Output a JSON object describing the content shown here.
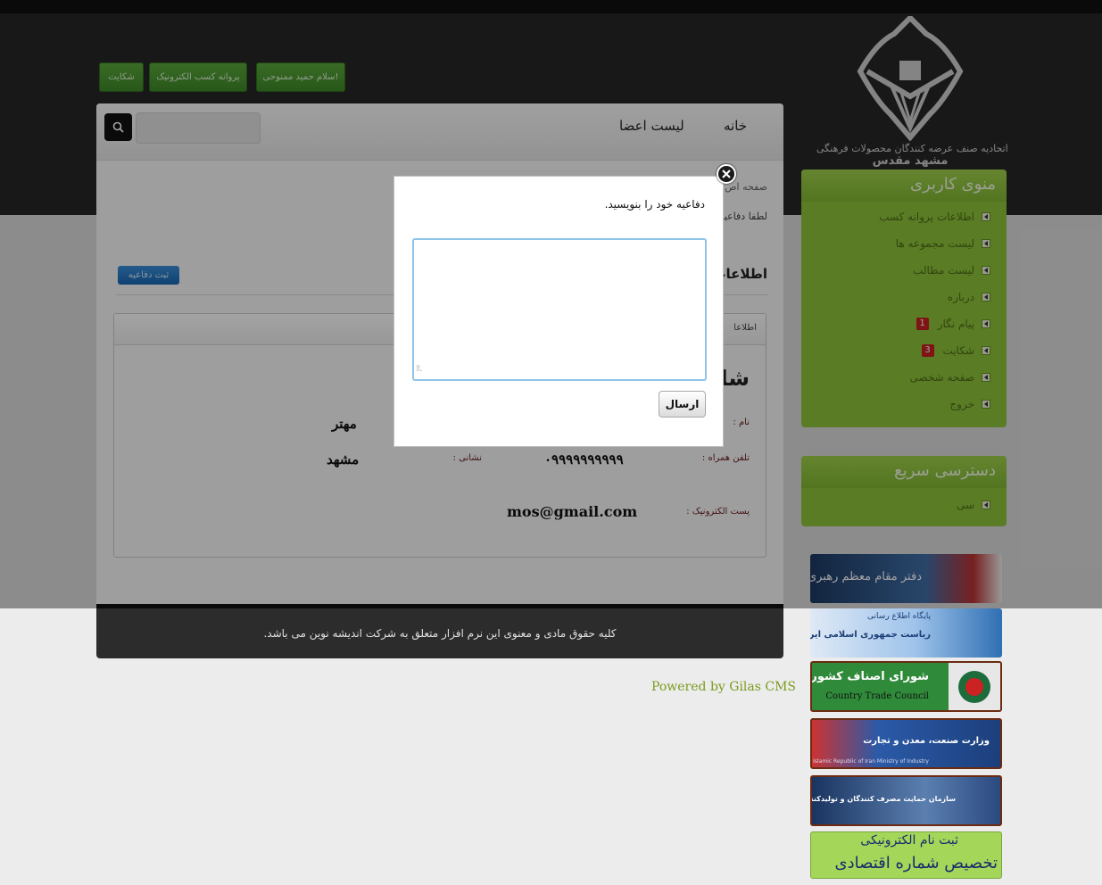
{
  "header": {
    "logo_line1": "اتحادیه صنف عرضه کنندگان محصولات فرهنگی",
    "logo_line2": "مشهد مقدس",
    "buttons": {
      "greeting": "سلام حمید ممنوحی!",
      "license": "پروانه کسب الکترونیک",
      "complaint": "شکایت"
    }
  },
  "nav": {
    "home": "خانه",
    "members": "لیست اعضا",
    "search_placeholder": ""
  },
  "content": {
    "breadcrumb": "صفحه اص",
    "instruction": "لطفا دفاعیه",
    "submit_defense": "ثبت دفاعیه",
    "section_title": "اطلاعات",
    "infobox_header": "اطلاعا",
    "big_letters": "شا",
    "fields": {
      "name_label": "نام :",
      "name_value": "مهتر",
      "mobile_label": "تلفن همراه :",
      "mobile_value": "۰۹۹۹۹۹۹۹۹۹۹",
      "address_label": "نشانی :",
      "address_value": "مشهد",
      "email_label": "پست الکترونیک :",
      "email_value": "mos@gmail.com"
    }
  },
  "footer": {
    "copyright": "کلیه حقوق مادی و معنوی این نرم افزار متعلق به شرکت اندیشه نوین می باشد.",
    "powered": "Powered by Gilas CMS"
  },
  "sidebar": {
    "user_menu": {
      "title": "منوی کاربری",
      "items": [
        {
          "label": "اطلاعات پروانه کسب",
          "badge": ""
        },
        {
          "label": "لیست مجموعه ها",
          "badge": ""
        },
        {
          "label": "لیست مطالب",
          "badge": ""
        },
        {
          "label": "درباره",
          "badge": ""
        },
        {
          "label": "پیام نگار",
          "badge": "1"
        },
        {
          "label": "شکایت",
          "badge": "3"
        },
        {
          "label": "صفحه شخصی",
          "badge": ""
        },
        {
          "label": "خروج",
          "badge": ""
        }
      ]
    },
    "quick_access": {
      "title": "دسترسی سریع",
      "items": [
        {
          "label": "سی"
        }
      ]
    }
  },
  "banners": {
    "leader": "دفتر مقام معظم رهبری",
    "president_top": "پایگاه اطلاع رسانی",
    "president": "ریاست جمهوری اسلامی ایران",
    "guild_fa": "شورای اصناف کشور",
    "guild_en": "Country Trade Council",
    "ministry": "وزارت صنعت، معدن و تجارت",
    "ministry_en": "Islamic Republic of Iran Ministry of Industry",
    "consumer": "سازمان حمایت مصرف کنندگان و تولیدکنندگان",
    "eco_line1": "ثبت نام الکترونیکی",
    "eco_line2": "تخصیص شماره اقتصادی"
  },
  "modal": {
    "title": "دفاعیه خود را بنویسید.",
    "textarea_value": "",
    "send": "ارسال"
  },
  "colors": {
    "sidebar_green": "#8dc23a",
    "button_green": "#4a9a32",
    "dark_header": "#262626",
    "link_olive": "#7a9b1f"
  }
}
